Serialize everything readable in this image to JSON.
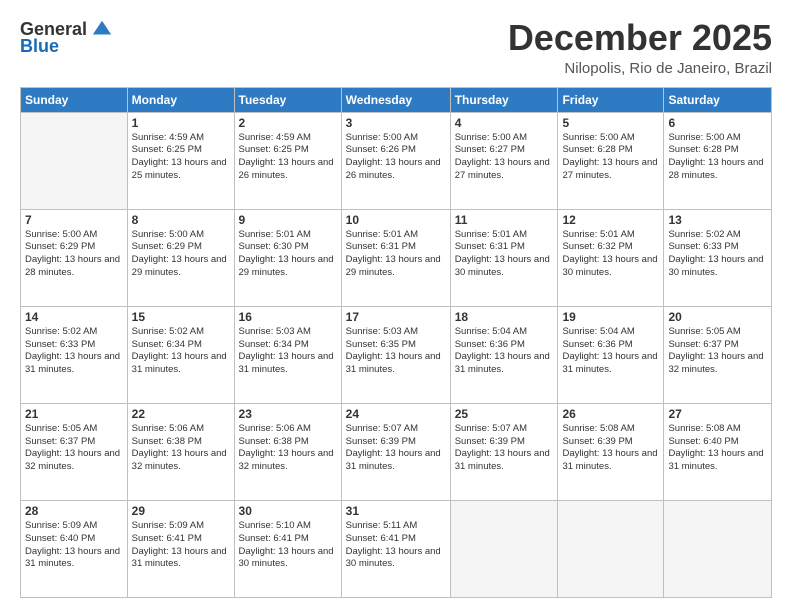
{
  "logo": {
    "general": "General",
    "blue": "Blue"
  },
  "header": {
    "title": "December 2025",
    "subtitle": "Nilopolis, Rio de Janeiro, Brazil"
  },
  "weekdays": [
    "Sunday",
    "Monday",
    "Tuesday",
    "Wednesday",
    "Thursday",
    "Friday",
    "Saturday"
  ],
  "weeks": [
    [
      {
        "day": "",
        "sunrise": "",
        "sunset": "",
        "daylight": ""
      },
      {
        "day": "1",
        "sunrise": "Sunrise: 4:59 AM",
        "sunset": "Sunset: 6:25 PM",
        "daylight": "Daylight: 13 hours and 25 minutes."
      },
      {
        "day": "2",
        "sunrise": "Sunrise: 4:59 AM",
        "sunset": "Sunset: 6:25 PM",
        "daylight": "Daylight: 13 hours and 26 minutes."
      },
      {
        "day": "3",
        "sunrise": "Sunrise: 5:00 AM",
        "sunset": "Sunset: 6:26 PM",
        "daylight": "Daylight: 13 hours and 26 minutes."
      },
      {
        "day": "4",
        "sunrise": "Sunrise: 5:00 AM",
        "sunset": "Sunset: 6:27 PM",
        "daylight": "Daylight: 13 hours and 27 minutes."
      },
      {
        "day": "5",
        "sunrise": "Sunrise: 5:00 AM",
        "sunset": "Sunset: 6:28 PM",
        "daylight": "Daylight: 13 hours and 27 minutes."
      },
      {
        "day": "6",
        "sunrise": "Sunrise: 5:00 AM",
        "sunset": "Sunset: 6:28 PM",
        "daylight": "Daylight: 13 hours and 28 minutes."
      }
    ],
    [
      {
        "day": "7",
        "sunrise": "Sunrise: 5:00 AM",
        "sunset": "Sunset: 6:29 PM",
        "daylight": "Daylight: 13 hours and 28 minutes."
      },
      {
        "day": "8",
        "sunrise": "Sunrise: 5:00 AM",
        "sunset": "Sunset: 6:29 PM",
        "daylight": "Daylight: 13 hours and 29 minutes."
      },
      {
        "day": "9",
        "sunrise": "Sunrise: 5:01 AM",
        "sunset": "Sunset: 6:30 PM",
        "daylight": "Daylight: 13 hours and 29 minutes."
      },
      {
        "day": "10",
        "sunrise": "Sunrise: 5:01 AM",
        "sunset": "Sunset: 6:31 PM",
        "daylight": "Daylight: 13 hours and 29 minutes."
      },
      {
        "day": "11",
        "sunrise": "Sunrise: 5:01 AM",
        "sunset": "Sunset: 6:31 PM",
        "daylight": "Daylight: 13 hours and 30 minutes."
      },
      {
        "day": "12",
        "sunrise": "Sunrise: 5:01 AM",
        "sunset": "Sunset: 6:32 PM",
        "daylight": "Daylight: 13 hours and 30 minutes."
      },
      {
        "day": "13",
        "sunrise": "Sunrise: 5:02 AM",
        "sunset": "Sunset: 6:33 PM",
        "daylight": "Daylight: 13 hours and 30 minutes."
      }
    ],
    [
      {
        "day": "14",
        "sunrise": "Sunrise: 5:02 AM",
        "sunset": "Sunset: 6:33 PM",
        "daylight": "Daylight: 13 hours and 31 minutes."
      },
      {
        "day": "15",
        "sunrise": "Sunrise: 5:02 AM",
        "sunset": "Sunset: 6:34 PM",
        "daylight": "Daylight: 13 hours and 31 minutes."
      },
      {
        "day": "16",
        "sunrise": "Sunrise: 5:03 AM",
        "sunset": "Sunset: 6:34 PM",
        "daylight": "Daylight: 13 hours and 31 minutes."
      },
      {
        "day": "17",
        "sunrise": "Sunrise: 5:03 AM",
        "sunset": "Sunset: 6:35 PM",
        "daylight": "Daylight: 13 hours and 31 minutes."
      },
      {
        "day": "18",
        "sunrise": "Sunrise: 5:04 AM",
        "sunset": "Sunset: 6:36 PM",
        "daylight": "Daylight: 13 hours and 31 minutes."
      },
      {
        "day": "19",
        "sunrise": "Sunrise: 5:04 AM",
        "sunset": "Sunset: 6:36 PM",
        "daylight": "Daylight: 13 hours and 31 minutes."
      },
      {
        "day": "20",
        "sunrise": "Sunrise: 5:05 AM",
        "sunset": "Sunset: 6:37 PM",
        "daylight": "Daylight: 13 hours and 32 minutes."
      }
    ],
    [
      {
        "day": "21",
        "sunrise": "Sunrise: 5:05 AM",
        "sunset": "Sunset: 6:37 PM",
        "daylight": "Daylight: 13 hours and 32 minutes."
      },
      {
        "day": "22",
        "sunrise": "Sunrise: 5:06 AM",
        "sunset": "Sunset: 6:38 PM",
        "daylight": "Daylight: 13 hours and 32 minutes."
      },
      {
        "day": "23",
        "sunrise": "Sunrise: 5:06 AM",
        "sunset": "Sunset: 6:38 PM",
        "daylight": "Daylight: 13 hours and 32 minutes."
      },
      {
        "day": "24",
        "sunrise": "Sunrise: 5:07 AM",
        "sunset": "Sunset: 6:39 PM",
        "daylight": "Daylight: 13 hours and 31 minutes."
      },
      {
        "day": "25",
        "sunrise": "Sunrise: 5:07 AM",
        "sunset": "Sunset: 6:39 PM",
        "daylight": "Daylight: 13 hours and 31 minutes."
      },
      {
        "day": "26",
        "sunrise": "Sunrise: 5:08 AM",
        "sunset": "Sunset: 6:39 PM",
        "daylight": "Daylight: 13 hours and 31 minutes."
      },
      {
        "day": "27",
        "sunrise": "Sunrise: 5:08 AM",
        "sunset": "Sunset: 6:40 PM",
        "daylight": "Daylight: 13 hours and 31 minutes."
      }
    ],
    [
      {
        "day": "28",
        "sunrise": "Sunrise: 5:09 AM",
        "sunset": "Sunset: 6:40 PM",
        "daylight": "Daylight: 13 hours and 31 minutes."
      },
      {
        "day": "29",
        "sunrise": "Sunrise: 5:09 AM",
        "sunset": "Sunset: 6:41 PM",
        "daylight": "Daylight: 13 hours and 31 minutes."
      },
      {
        "day": "30",
        "sunrise": "Sunrise: 5:10 AM",
        "sunset": "Sunset: 6:41 PM",
        "daylight": "Daylight: 13 hours and 30 minutes."
      },
      {
        "day": "31",
        "sunrise": "Sunrise: 5:11 AM",
        "sunset": "Sunset: 6:41 PM",
        "daylight": "Daylight: 13 hours and 30 minutes."
      },
      {
        "day": "",
        "sunrise": "",
        "sunset": "",
        "daylight": ""
      },
      {
        "day": "",
        "sunrise": "",
        "sunset": "",
        "daylight": ""
      },
      {
        "day": "",
        "sunrise": "",
        "sunset": "",
        "daylight": ""
      }
    ]
  ]
}
